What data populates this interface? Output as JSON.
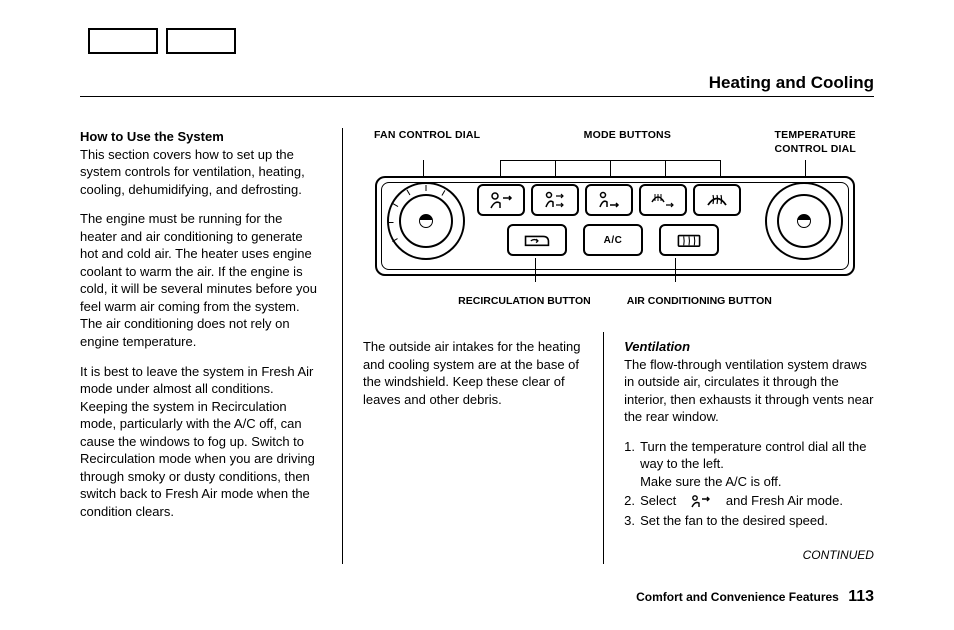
{
  "page_title": "Heating and Cooling",
  "footer": {
    "section": "Comfort and Convenience Features",
    "page_number": "113"
  },
  "diagram": {
    "labels": {
      "fan": "FAN CONTROL DIAL",
      "mode": "MODE BUTTONS",
      "temp": "TEMPERATURE CONTROL DIAL",
      "recirc": "RECIRCULATION BUTTON",
      "ac": "AIR CONDITIONING BUTTON"
    },
    "ac_button_text": "A/C"
  },
  "col1": {
    "heading": "How to Use the System",
    "p1": "This section covers how to set up the system controls for ventilation, heating, cooling, dehumidifying, and defrosting.",
    "p2a": "The engine must be running for the heater and air conditioning to generate hot and cold air. The heater uses engine coolant to warm the air. If the engine is cold, it will be several minutes before you feel warm air coming from the system.",
    "p2b": "The air conditioning does not rely on engine temperature.",
    "p3": "It is best to leave the system in Fresh Air mode under almost all conditions. Keeping the system in Recirculation mode, particularly with the A/C off, can cause the windows to fog up. Switch to Recirculation mode when you are driving through smoky or dusty conditions, then switch back to Fresh Air mode when the condition clears."
  },
  "col2": {
    "p1": "The outside air intakes for the heating and cooling system are at the base of the windshield. Keep these clear of leaves and other debris."
  },
  "col3": {
    "heading": "Ventilation",
    "p1": "The flow-through ventilation system draws in outside air, circulates it through the interior, then exhausts it through vents near the rear window.",
    "steps": [
      "Turn the temperature control dial all the way to the left.\nMake sure the A/C is off.",
      "Select    and Fresh Air mode.",
      "Set the fan to the desired speed."
    ],
    "continued": "CONTINUED"
  }
}
